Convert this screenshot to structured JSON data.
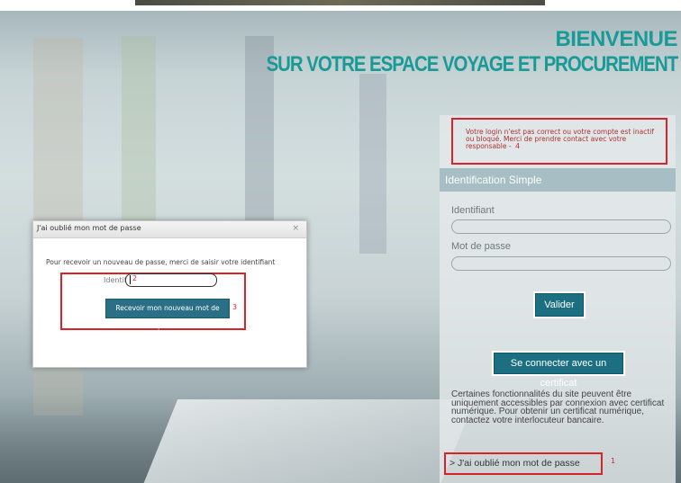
{
  "header": {
    "line1": "BIENVENUE",
    "line2": "SUR VOTRE ESPACE VOYAGE ET PROCUREMENT"
  },
  "login_panel": {
    "error_message": "Votre login n'est pas correct ou votre compte est inactif ou bloqué. Merci de prendre contact avec votre responsable",
    "error_marker": "4",
    "section_title": "Identification Simple",
    "identifiant_label": "Identifiant",
    "password_label": "Mot de passe",
    "submit_label": "Valider",
    "certificate_button": "Se connecter avec un certificat",
    "certificate_note": "Certaines fonctionnalités du site peuvent être uniquement accessibles par connexion avec certificat numérique. Pour obtenir un certificat numérique, contactez votre interlocuteur bancaire.",
    "forgot_link": "> J'ai oublié mon mot de passe",
    "forgot_marker": "1"
  },
  "dialog": {
    "title": "J'ai oublié mon mot de passe",
    "close_glyph": "×",
    "instruction": "Pour recevoir un nouveau de passe, merci de saisir votre identifiant",
    "field_label": "Identifiant *",
    "field_marker": "2",
    "button_label": "Recevoir mon nouveau mot de passe",
    "button_marker": "3"
  },
  "colors": {
    "accent_teal": "#1a9a96",
    "button_teal": "#1b6f80",
    "annotation_red": "#d8232a"
  }
}
